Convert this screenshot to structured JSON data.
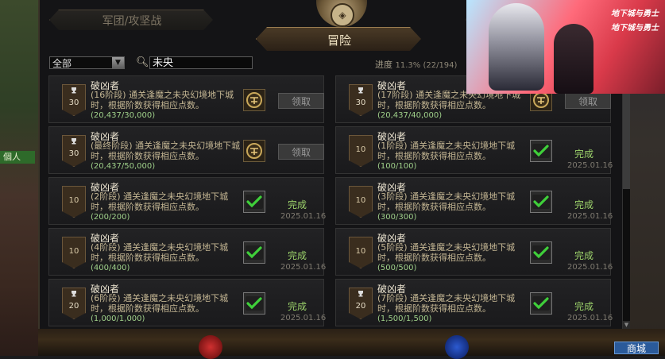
{
  "tabs": {
    "legion": "军团/攻坚战",
    "adventure": "冒险"
  },
  "filter": {
    "selected": "全部"
  },
  "search": {
    "value": "未央"
  },
  "progress": {
    "label": "进度",
    "value": "11.3% (22/194)"
  },
  "cards": [
    {
      "title": "破凶者",
      "desc": "(16阶段) 通关逢魔之未央幻境地下城时，根据阶数获得相应点数。",
      "progress": "(20,437/30,000)",
      "points": "30",
      "trophy": true,
      "state": "claim",
      "action": "领取"
    },
    {
      "title": "破凶者",
      "desc": "(17阶段) 通关逢魔之未央幻境地下城时，根据阶数获得相应点数。",
      "progress": "(20,437/40,000)",
      "points": "30",
      "trophy": true,
      "state": "claim",
      "action": "领取"
    },
    {
      "title": "破凶者",
      "desc": "(最终阶段) 通关逢魔之未央幻境地下城时，根据阶数获得相应点数。",
      "progress": "(20,437/50,000)",
      "points": "30",
      "trophy": true,
      "state": "claim",
      "action": "领取"
    },
    {
      "title": "破凶者",
      "desc": "(1阶段) 通关逢魔之未央幻境地下城时，根据阶数获得相应点数。",
      "progress": "(100/100)",
      "points": "10",
      "trophy": false,
      "state": "done",
      "status": "完成",
      "date": "2025.01.16"
    },
    {
      "title": "破凶者",
      "desc": "(2阶段) 通关逢魔之未央幻境地下城时，根据阶数获得相应点数。",
      "progress": "(200/200)",
      "points": "10",
      "trophy": false,
      "state": "done",
      "status": "完成",
      "date": "2025.01.16"
    },
    {
      "title": "破凶者",
      "desc": "(3阶段) 通关逢魔之未央幻境地下城时，根据阶数获得相应点数。",
      "progress": "(300/300)",
      "points": "10",
      "trophy": false,
      "state": "done",
      "status": "完成",
      "date": "2025.01.16"
    },
    {
      "title": "破凶者",
      "desc": "(4阶段) 通关逢魔之未央幻境地下城时，根据阶数获得相应点数。",
      "progress": "(400/400)",
      "points": "10",
      "trophy": false,
      "state": "done",
      "status": "完成",
      "date": "2025.01.16"
    },
    {
      "title": "破凶者",
      "desc": "(5阶段) 通关逢魔之未央幻境地下城时，根据阶数获得相应点数。",
      "progress": "(500/500)",
      "points": "10",
      "trophy": false,
      "state": "done",
      "status": "完成",
      "date": "2025.01.16"
    },
    {
      "title": "破凶者",
      "desc": "(6阶段) 通关逢魔之未央幻境地下城时，根据阶数获得相应点数。",
      "progress": "(1,000/1,000)",
      "points": "20",
      "trophy": true,
      "state": "done",
      "status": "完成",
      "date": "2025.01.16"
    },
    {
      "title": "破凶者",
      "desc": "(7阶段) 通关逢魔之未央幻境地下城时，根据阶数获得相应点数。",
      "progress": "(1,500/1,500)",
      "points": "20",
      "trophy": true,
      "state": "done",
      "status": "完成",
      "date": "2025.01.16"
    }
  ],
  "ad": {
    "logo1": "地下城与勇士",
    "logo2": "地下城与勇士"
  },
  "side": {
    "tag": "個人"
  },
  "hud": {
    "shop": "商城"
  }
}
